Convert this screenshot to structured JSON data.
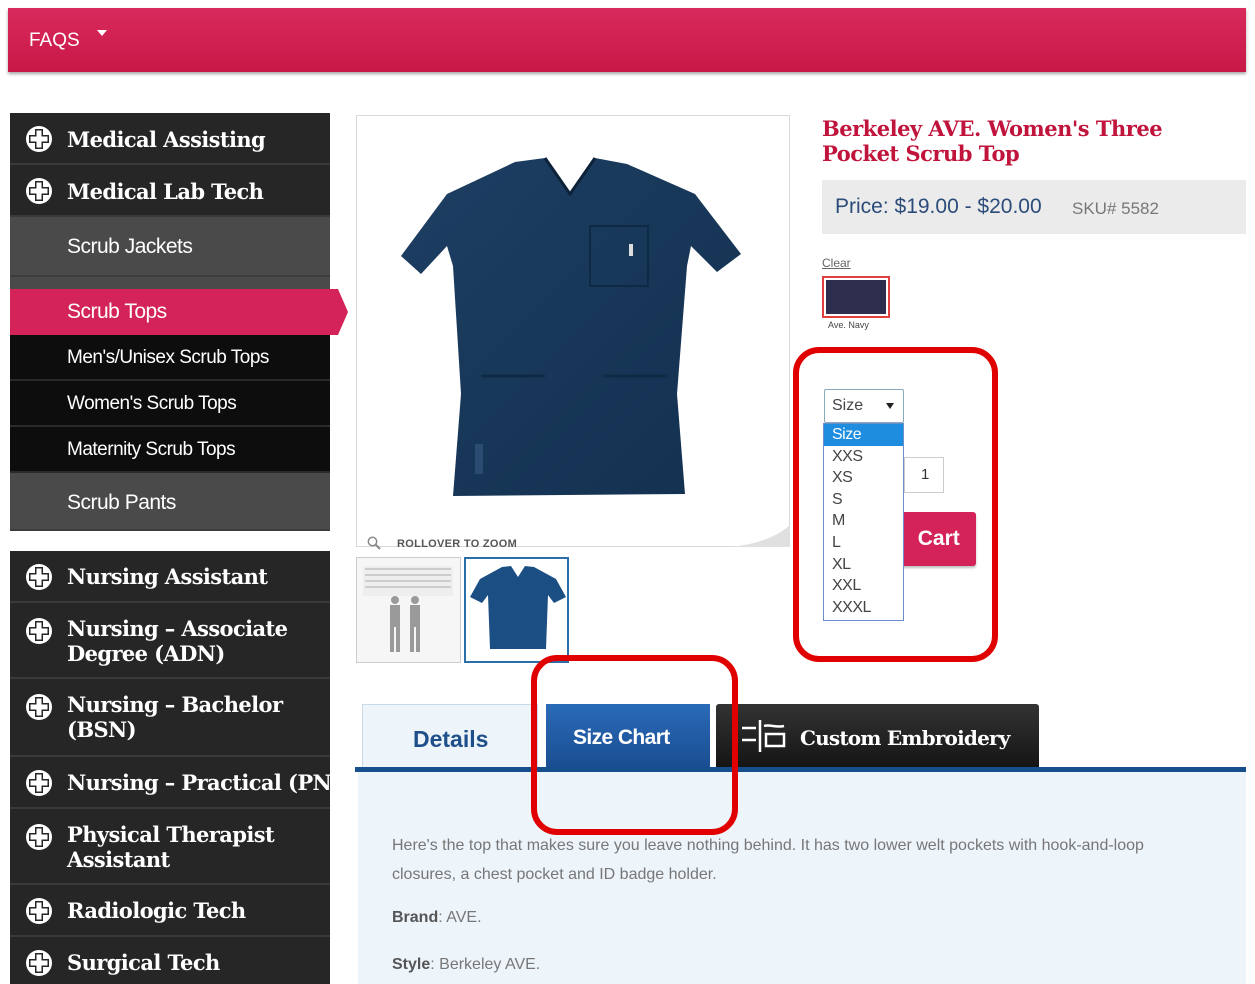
{
  "topbar": {
    "faqs_label": "FAQS"
  },
  "sidebar": {
    "categories": [
      {
        "label": "Medical Assisting"
      },
      {
        "label": "Medical Lab Tech"
      }
    ],
    "scrub_jackets": "Scrub Jackets",
    "scrub_tops": "Scrub Tops",
    "mens_tops": "Men's/Unisex Scrub Tops",
    "womens_tops": "Women's Scrub Tops",
    "maternity_tops": "Maternity Scrub Tops",
    "scrub_pants": "Scrub Pants",
    "categories2": [
      {
        "label": "Nursing Assistant"
      },
      {
        "label": "Nursing – Associate Degree (ADN)"
      },
      {
        "label": "Nursing – Bachelor (BSN)"
      },
      {
        "label": "Nursing – Practical (PN)"
      },
      {
        "label": "Physical Therapist Assistant"
      },
      {
        "label": "Radiologic Tech"
      },
      {
        "label": "Surgical Tech"
      }
    ]
  },
  "image": {
    "zoom_hint": "ROLLOVER TO ZOOM"
  },
  "product": {
    "title": "Berkeley AVE. Women's Three Pocket Scrub Top",
    "price": "Price: $19.00 - $20.00",
    "sku": "SKU# 5582",
    "clear_label": "Clear",
    "swatch_label": "Ave. Navy",
    "swatch_color": "#2e2e4e",
    "size_selected": "Size",
    "size_options": [
      "Size",
      "XXS",
      "XS",
      "S",
      "M",
      "L",
      "XL",
      "XXL",
      "XXXL"
    ],
    "quantity": "1",
    "add_to_cart_visible": "Cart"
  },
  "tabs": {
    "details": "Details",
    "size_chart": "Size Chart",
    "custom_embroidery": "Custom Embroidery"
  },
  "details": {
    "description": "Here's the top that makes sure you leave nothing behind.  It has two lower welt pockets with hook-and-loop closures, a chest pocket and ID badge holder.",
    "brand_label": "Brand",
    "brand_value": ": AVE.",
    "style_label": "Style",
    "style_value": ": Berkeley AVE."
  },
  "colors": {
    "brand_pink": "#d42358",
    "tab_blue": "#1a4e92",
    "annotation_red": "#e00000"
  }
}
